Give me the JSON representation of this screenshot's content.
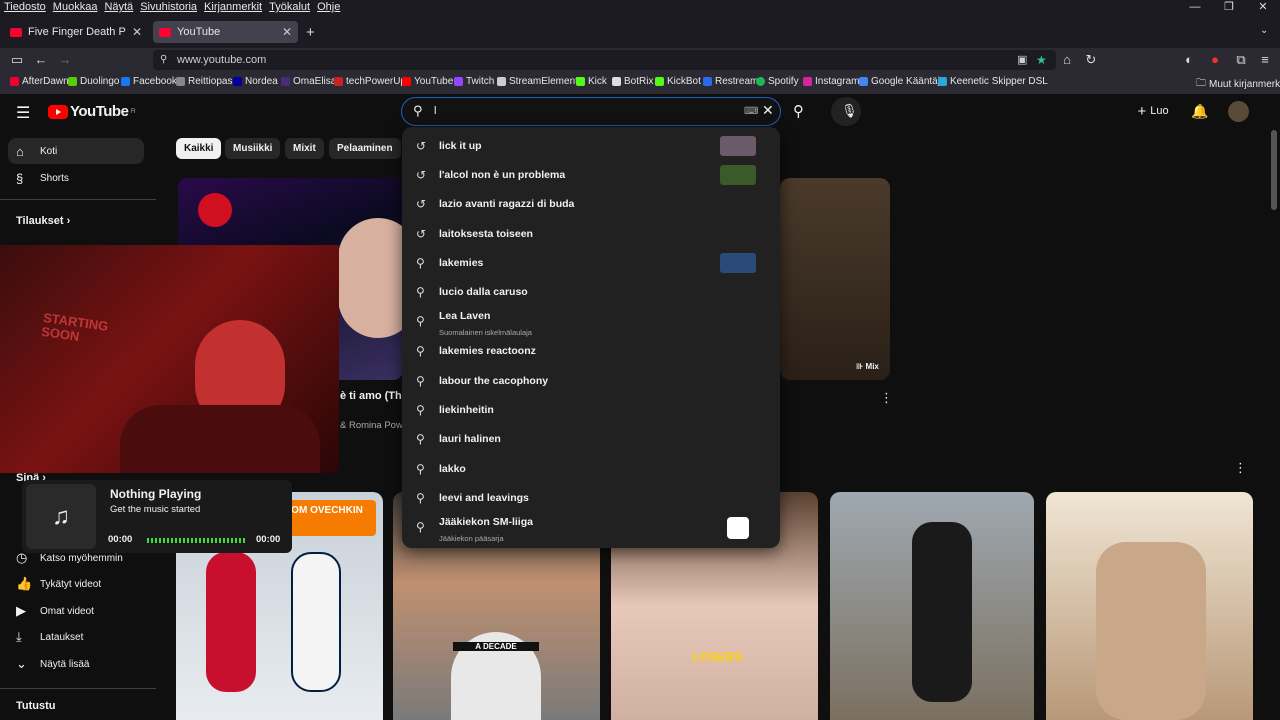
{
  "menu": [
    "Tiedosto",
    "Muokkaa",
    "Näytä",
    "Sivuhistoria",
    "Kirjanmerkit",
    "Työkalut",
    "Ohje"
  ],
  "tabs": [
    {
      "title": "Five Finger Death Punch - Wro"
    },
    {
      "title": "YouTube"
    }
  ],
  "url": "www.youtube.com",
  "bookmarks": [
    "AfterDawn",
    "Duolingo",
    "Facebook",
    "Reittiopas",
    "Nordea",
    "OmaElisa",
    "techPowerUp",
    "YouTube",
    "Twitch",
    "StreamElements",
    "Kick",
    "BotRix",
    "KickBot",
    "Restream",
    "Spotify",
    "Instagram",
    "Google Kääntäjä",
    "Keenetic Skipper DSL"
  ],
  "bookmarks_other": "Muut kirjanmerkit",
  "yt": {
    "logo": "YouTube",
    "region": "FI",
    "search_value": "l",
    "create_label": "Luo"
  },
  "sidebar": {
    "home": "Koti",
    "shorts": "Shorts",
    "subscriptions": "Tilaukset",
    "you": "Sinä",
    "watch_later": "Katso myöhemmin",
    "liked": "Tykätyt videot",
    "your_videos": "Omat videot",
    "downloads": "Lataukset",
    "show_more": "Näytä lisää",
    "explore": "Tutustu"
  },
  "chips": [
    "Kaikki",
    "Musiikki",
    "Mixit",
    "Pelaaminen"
  ],
  "suggestions": [
    {
      "text": "lick it up",
      "type": "history",
      "thumb": "#6a5a6a"
    },
    {
      "text": "l'alcol non è un problema",
      "type": "history",
      "thumb": "#3a5a2a"
    },
    {
      "text": "lazio avanti ragazzi di buda",
      "type": "history"
    },
    {
      "text": "laitoksesta toiseen",
      "type": "history"
    },
    {
      "text": "lakemies",
      "type": "search",
      "thumb": "#2a4a7a"
    },
    {
      "text": "lucio dalla caruso",
      "type": "search"
    },
    {
      "text": "Lea Laven",
      "sub": "Suomalainen iskelmälaulaja",
      "type": "search"
    },
    {
      "text": "lakemies reactoonz",
      "type": "search"
    },
    {
      "text": "labour the cacophony",
      "type": "search"
    },
    {
      "text": "liekinheitin",
      "type": "search"
    },
    {
      "text": "lauri halinen",
      "type": "search"
    },
    {
      "text": "lakko",
      "type": "search"
    },
    {
      "text": "leevi and leavings",
      "type": "search"
    },
    {
      "text": "Jääkiekon SM-liiga",
      "sub": "Jääkiekon pääsarja",
      "type": "search",
      "thumb": "#ffffff"
    }
  ],
  "video": {
    "partial_title": "è ti amo (Thor",
    "partial_channel": "& Romina Powe",
    "mix_badge": "Mix"
  },
  "shorts_texts": {
    "short1_banner": "ETS SAVED FROM OVECHKIN",
    "short2_caption": "A DECADE",
    "short3_caption": "LOSERS"
  },
  "overlay": {
    "cam_sign": "STARTING SOON",
    "player_title": "Nothing Playing",
    "player_sub": "Get the music started",
    "time_left": "00:00",
    "time_right": "00:00"
  },
  "colors": {
    "accent_red": "#ff0000",
    "focus_blue": "#1c62b9",
    "firefox_star": "#2ac3a2"
  }
}
